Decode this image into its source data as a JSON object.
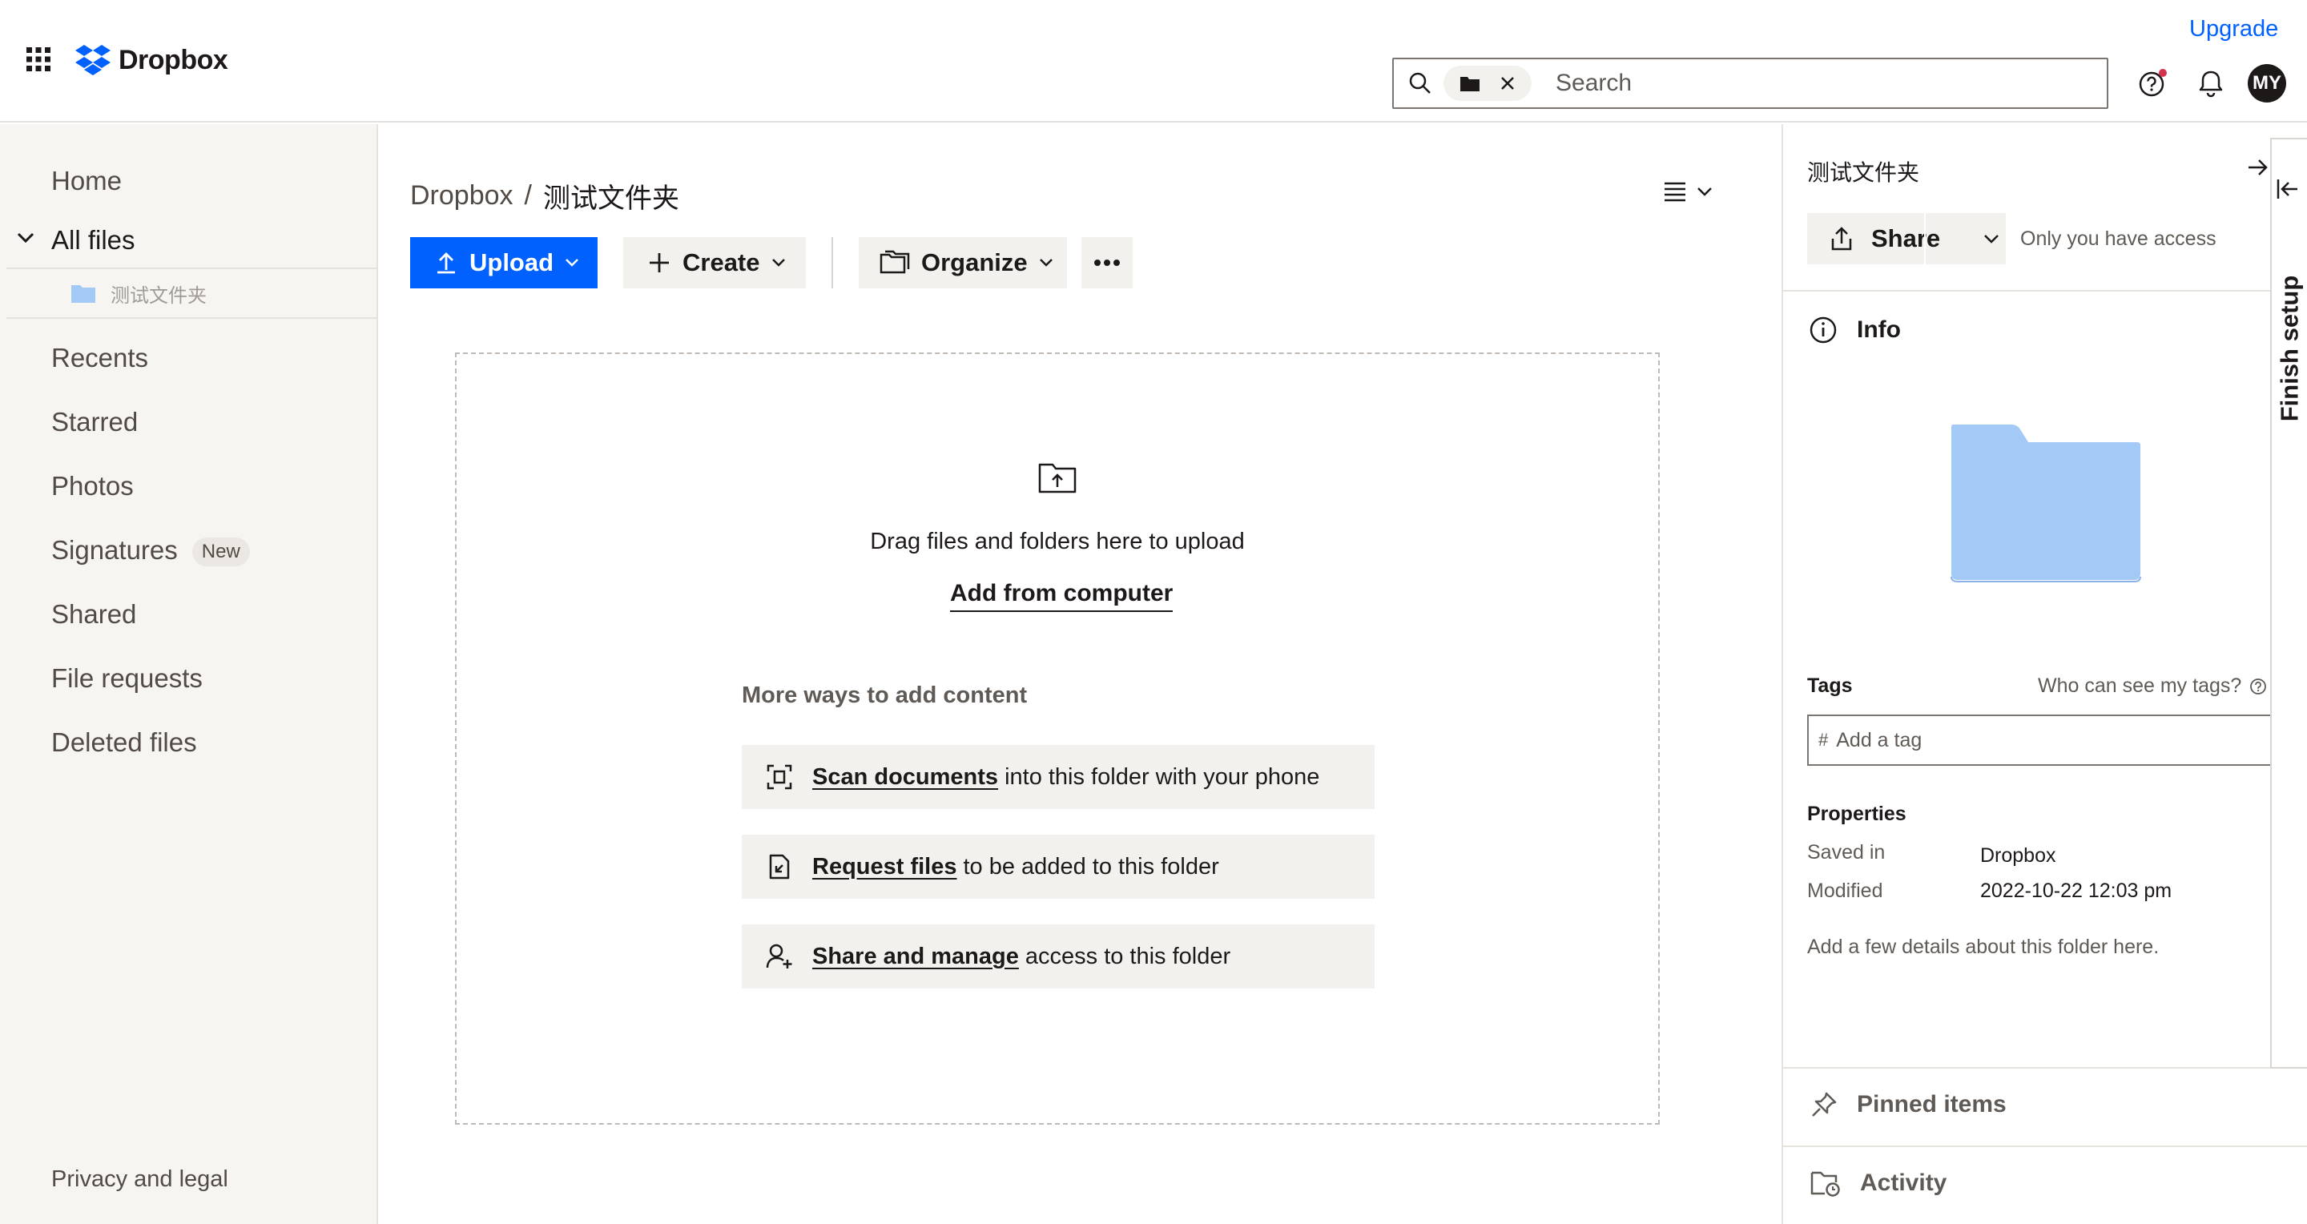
{
  "header": {
    "logo_text": "Dropbox",
    "upgrade_label": "Upgrade",
    "search_placeholder": "Search",
    "avatar_initials": "MY"
  },
  "sidebar": {
    "items": [
      {
        "label": "Home"
      },
      {
        "label": "All files"
      },
      {
        "label": "Recents"
      },
      {
        "label": "Starred"
      },
      {
        "label": "Photos"
      },
      {
        "label": "Signatures",
        "badge": "New"
      },
      {
        "label": "Shared"
      },
      {
        "label": "File requests"
      },
      {
        "label": "Deleted files"
      }
    ],
    "subfolder": "测试文件夹",
    "footer": "Privacy and legal"
  },
  "main": {
    "breadcrumb": {
      "root": "Dropbox",
      "separator": "/",
      "current": "测试文件夹"
    },
    "toolbar": {
      "upload_label": "Upload",
      "create_label": "Create",
      "organize_label": "Organize"
    },
    "dropzone": {
      "text": "Drag files and folders here to upload",
      "add_label": "Add from computer",
      "more_ways_title": "More ways to add content",
      "ways": [
        {
          "strong": "Scan documents",
          "rest": "into this folder with your phone",
          "icon": "scan-icon"
        },
        {
          "strong": "Request files",
          "rest": "to be added to this folder",
          "icon": "request-file-icon"
        },
        {
          "strong": "Share and manage",
          "rest": "access to this folder",
          "icon": "share-person-icon"
        }
      ]
    }
  },
  "details_panel": {
    "title": "测试文件夹",
    "share_label": "Share",
    "access_text": "Only you have access",
    "info_label": "Info",
    "tags_label": "Tags",
    "tags_help": "Who can see my tags?",
    "tag_placeholder": "Add a tag",
    "properties_label": "Properties",
    "properties": [
      {
        "key": "Saved in",
        "value": "Dropbox"
      },
      {
        "key": "Modified",
        "value": "2022-10-22 12:03 pm"
      }
    ],
    "add_details": "Add a few details about this folder here.",
    "pinned_label": "Pinned items",
    "activity_label": "Activity"
  },
  "finish_setup": {
    "label": "Finish setup"
  },
  "colors": {
    "accent": "#0061fe",
    "sidebar_bg": "#f7f5f2",
    "button_bg": "#f3f1ee",
    "folder": "#a3c9f7",
    "notification_dot": "#d5304d"
  }
}
